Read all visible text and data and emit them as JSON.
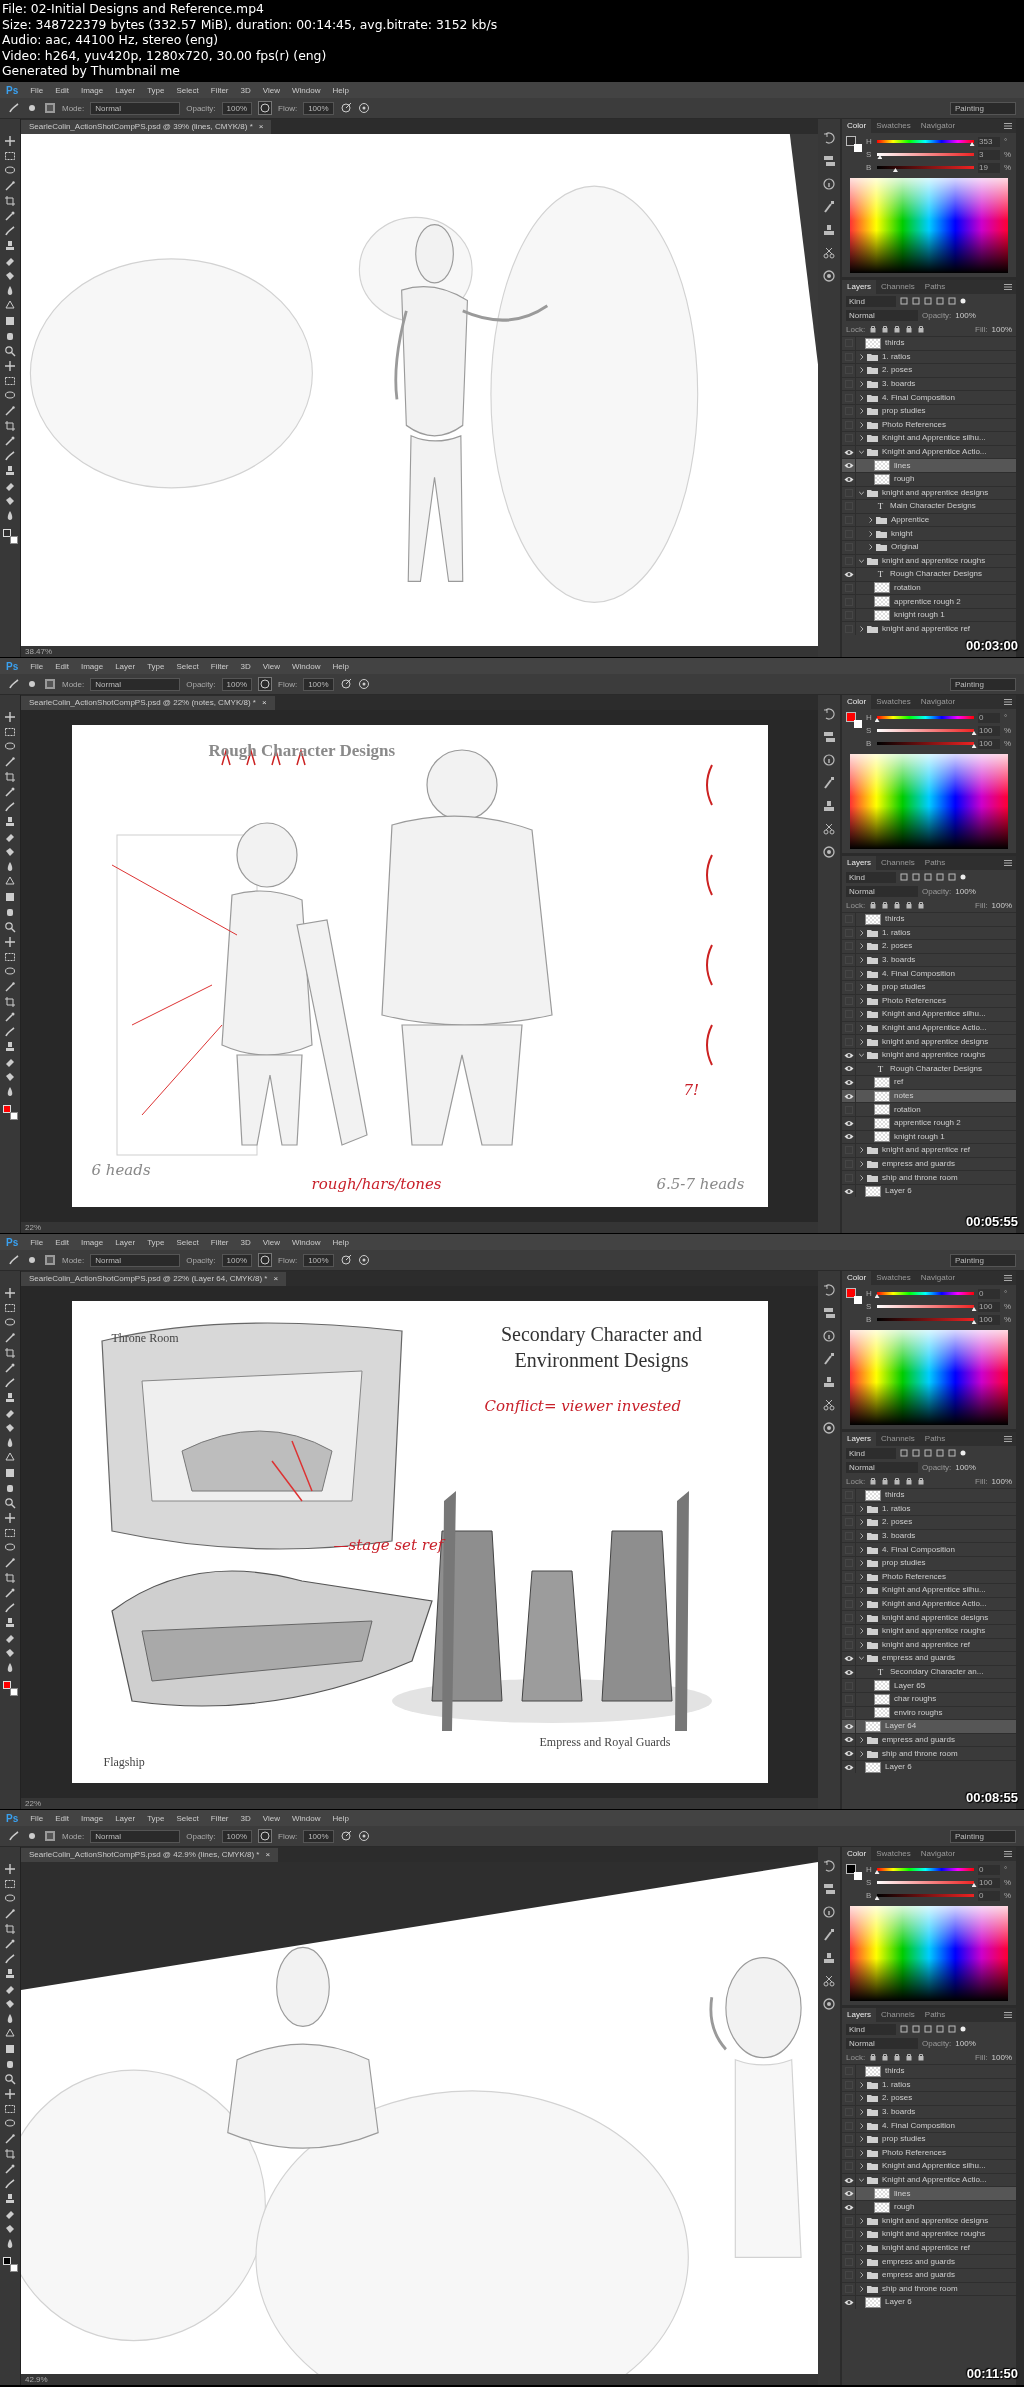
{
  "header": [
    "File: 02-Initial Designs and Reference.mp4",
    "Size: 348722379 bytes (332.57 MiB), duration: 00:14:45, avg.bitrate: 3152 kb/s",
    "Audio: aac, 44100 Hz, stereo (eng)",
    "Video: h264, yuv420p, 1280x720, 30.00 fps(r) (eng)",
    "Generated by Thumbnail me"
  ],
  "frames": [
    {
      "logo": "Ps",
      "menu": [
        "File",
        "Edit",
        "Image",
        "Layer",
        "Type",
        "Select",
        "Filter",
        "3D",
        "View",
        "Window",
        "Help"
      ],
      "options": {
        "mode_label": "Mode:",
        "mode": "Normal",
        "opacity_label": "Opacity:",
        "opacity": "100%",
        "flow_label": "Flow:",
        "flow": "100%",
        "workspace": "Painting"
      },
      "doc_tab": "SearleColin_ActionShotCompPS.psd @ 39% (lines, CMYK/8) *",
      "close": "×",
      "canvas": {
        "kind": "figure_sketch"
      },
      "color_tabs": [
        {
          "label": "Color",
          "selected": true
        },
        {
          "label": "Swatches",
          "selected": false
        },
        {
          "label": "Navigator",
          "selected": false
        }
      ],
      "color": {
        "sliders": [
          {
            "label": "H",
            "value": "353",
            "unit": "°",
            "level": 0.98
          },
          {
            "label": "S",
            "value": "3",
            "unit": "%",
            "level": 0.03
          },
          {
            "label": "B",
            "value": "19",
            "unit": "%",
            "level": 0.19
          }
        ]
      },
      "layer_tabs": [
        {
          "label": "Layers",
          "selected": true
        },
        {
          "label": "Channels",
          "selected": false
        },
        {
          "label": "Paths",
          "selected": false
        }
      ],
      "layer_controls": {
        "filter": "Kind",
        "blend": "Normal",
        "opacity_label": "Opacity:",
        "opacity": "100%",
        "lock_label": "Lock:",
        "fill_label": "Fill:",
        "fill": "100%"
      },
      "layers": [
        {
          "name": "thirds",
          "kind": "layer",
          "visible": false,
          "selected": false
        },
        {
          "name": "1. ratios",
          "kind": "group",
          "visible": false,
          "selected": false,
          "expanded": false
        },
        {
          "name": "2. poses",
          "kind": "group",
          "visible": false,
          "selected": false,
          "expanded": false
        },
        {
          "name": "3. boards",
          "kind": "group",
          "visible": false,
          "selected": false,
          "expanded": false
        },
        {
          "name": "4. Final Composition",
          "kind": "group",
          "visible": false,
          "selected": false,
          "expanded": false
        },
        {
          "name": "prop studies",
          "kind": "group",
          "visible": false,
          "selected": false,
          "expanded": false
        },
        {
          "name": "Photo References",
          "kind": "group",
          "visible": false,
          "selected": false,
          "expanded": false
        },
        {
          "name": "Knight and Apprentice silhu...",
          "kind": "group",
          "visible": false,
          "selected": false,
          "expanded": false
        },
        {
          "name": "Knight and Apprentice Actio...",
          "kind": "group",
          "visible": true,
          "selected": false,
          "expanded": true,
          "children": [
            {
              "name": "lines",
              "kind": "layer",
              "visible": true,
              "selected": true
            },
            {
              "name": "rough",
              "kind": "layer",
              "visible": true,
              "selected": false
            }
          ]
        },
        {
          "name": "knight and apprentice designs",
          "kind": "group",
          "visible": false,
          "selected": false,
          "expanded": true,
          "children": [
            {
              "name": "Main Character Designs",
              "kind": "text",
              "glyph": "T",
              "visible": false,
              "selected": false
            },
            {
              "name": "Apprentice",
              "kind": "group",
              "visible": false,
              "selected": false,
              "expanded": false
            },
            {
              "name": "knight",
              "kind": "group",
              "visible": false,
              "selected": false,
              "expanded": false
            },
            {
              "name": "Original",
              "kind": "group",
              "visible": false,
              "selected": false,
              "expanded": false
            }
          ]
        },
        {
          "name": "knight and apprentice roughs",
          "kind": "group",
          "visible": false,
          "selected": false,
          "expanded": true,
          "children": [
            {
              "name": "Rough Character Designs",
              "kind": "text",
              "glyph": "T",
              "visible": true,
              "selected": false
            },
            {
              "name": "rotation",
              "kind": "layer",
              "visible": false,
              "selected": false
            },
            {
              "name": "apprentice rough 2",
              "kind": "layer",
              "visible": false,
              "selected": false
            },
            {
              "name": "knight rough 1",
              "kind": "layer",
              "visible": false,
              "selected": false
            }
          ]
        },
        {
          "name": "knight and apprentice ref",
          "kind": "group",
          "visible": false,
          "selected": false,
          "expanded": false
        }
      ],
      "zoom": "38.47%",
      "timestamp": "00:03:00"
    },
    {
      "logo": "Ps",
      "menu": [
        "File",
        "Edit",
        "Image",
        "Layer",
        "Type",
        "Select",
        "Filter",
        "3D",
        "View",
        "Window",
        "Help"
      ],
      "options": {
        "mode_label": "Mode:",
        "mode": "Normal",
        "opacity_label": "Opacity:",
        "opacity": "100%",
        "flow_label": "Flow:",
        "flow": "100%",
        "workspace": "Painting"
      },
      "doc_tab": "SearleColin_ActionShotCompPS.psd @ 22% (notes, CMYK/8) *",
      "close": "×",
      "canvas": {
        "kind": "rough_sheet",
        "texts": [
          {
            "text": "Rough Character Designs",
            "kind": "title"
          },
          {
            "text": "6 heads",
            "kind": "handwriting"
          },
          {
            "text": "rough/hars/tones",
            "kind": "note"
          },
          {
            "text": "6.5-7 heads",
            "kind": "handwriting"
          },
          {
            "text": "7!",
            "kind": "note"
          }
        ]
      },
      "color_tabs": [
        {
          "label": "Color",
          "selected": true
        },
        {
          "label": "Swatches",
          "selected": false
        },
        {
          "label": "Navigator",
          "selected": false
        }
      ],
      "color": {
        "sliders": [
          {
            "label": "H",
            "value": "0",
            "unit": "°",
            "level": 0
          },
          {
            "label": "S",
            "value": "100",
            "unit": "%",
            "level": 1
          },
          {
            "label": "B",
            "value": "100",
            "unit": "%",
            "level": 1
          }
        ]
      },
      "layer_tabs": [
        {
          "label": "Layers",
          "selected": true
        },
        {
          "label": "Channels",
          "selected": false
        },
        {
          "label": "Paths",
          "selected": false
        }
      ],
      "layer_controls": {
        "filter": "Kind",
        "blend": "Normal",
        "opacity_label": "Opacity:",
        "opacity": "100%",
        "lock_label": "Lock:",
        "fill_label": "Fill:",
        "fill": "100%"
      },
      "layers": [
        {
          "name": "thirds",
          "kind": "layer",
          "visible": false,
          "selected": false
        },
        {
          "name": "1. ratios",
          "kind": "group",
          "visible": false,
          "selected": false,
          "expanded": false
        },
        {
          "name": "2. poses",
          "kind": "group",
          "visible": false,
          "selected": false,
          "expanded": false
        },
        {
          "name": "3. boards",
          "kind": "group",
          "visible": false,
          "selected": false,
          "expanded": false
        },
        {
          "name": "4. Final Composition",
          "kind": "group",
          "visible": false,
          "selected": false,
          "expanded": false
        },
        {
          "name": "prop studies",
          "kind": "group",
          "visible": false,
          "selected": false,
          "expanded": false
        },
        {
          "name": "Photo References",
          "kind": "group",
          "visible": false,
          "selected": false,
          "expanded": false
        },
        {
          "name": "Knight and Apprentice silhu...",
          "kind": "group",
          "visible": false,
          "selected": false,
          "expanded": false
        },
        {
          "name": "Knight and Apprentice Actio...",
          "kind": "group",
          "visible": false,
          "selected": false,
          "expanded": false
        },
        {
          "name": "knight and apprentice designs",
          "kind": "group",
          "visible": false,
          "selected": false,
          "expanded": false
        },
        {
          "name": "knight and apprentice roughs",
          "kind": "group",
          "visible": true,
          "selected": false,
          "expanded": true,
          "children": [
            {
              "name": "Rough Character Designs",
              "kind": "text",
              "glyph": "T",
              "visible": true,
              "selected": false
            },
            {
              "name": "ref",
              "kind": "layer",
              "visible": true,
              "selected": false
            },
            {
              "name": "notes",
              "kind": "layer",
              "visible": true,
              "selected": true
            },
            {
              "name": "rotation",
              "kind": "layer",
              "visible": false,
              "selected": false
            },
            {
              "name": "apprentice rough 2",
              "kind": "layer",
              "visible": true,
              "selected": false
            },
            {
              "name": "knight rough 1",
              "kind": "layer",
              "visible": true,
              "selected": false
            }
          ]
        },
        {
          "name": "knight and apprentice ref",
          "kind": "group",
          "visible": false,
          "selected": false,
          "expanded": false
        },
        {
          "name": "empress and guards",
          "kind": "group",
          "visible": false,
          "selected": false,
          "expanded": false
        },
        {
          "name": "ship and throne room",
          "kind": "group",
          "visible": false,
          "selected": false,
          "expanded": false
        },
        {
          "name": "Layer 6",
          "kind": "layer",
          "visible": true,
          "selected": false
        }
      ],
      "zoom": "22%",
      "timestamp": "00:05:55"
    },
    {
      "logo": "Ps",
      "menu": [
        "File",
        "Edit",
        "Image",
        "Layer",
        "Type",
        "Select",
        "Filter",
        "3D",
        "View",
        "Window",
        "Help"
      ],
      "options": {
        "mode_label": "Mode:",
        "mode": "Normal",
        "opacity_label": "Opacity:",
        "opacity": "100%",
        "flow_label": "Flow:",
        "flow": "100%",
        "workspace": "Painting"
      },
      "doc_tab": "SearleColin_ActionShotCompPS.psd @ 22% (Layer 64, CMYK/8) *",
      "close": "×",
      "canvas": {
        "kind": "secondary_sheet",
        "texts": [
          {
            "text": "Throne Room",
            "kind": "caption"
          },
          {
            "text": "Secondary Character and Environment Designs",
            "kind": "heading"
          },
          {
            "text": "Conflict= viewer invested",
            "kind": "note"
          },
          {
            "text": "—stage set ref",
            "kind": "note"
          },
          {
            "text": "Flagship",
            "kind": "caption"
          },
          {
            "text": "Empress and Royal Guards",
            "kind": "caption"
          }
        ]
      },
      "color_tabs": [
        {
          "label": "Color",
          "selected": true
        },
        {
          "label": "Swatches",
          "selected": false
        },
        {
          "label": "Navigator",
          "selected": false
        }
      ],
      "color": {
        "sliders": [
          {
            "label": "H",
            "value": "0",
            "unit": "°",
            "level": 0
          },
          {
            "label": "S",
            "value": "100",
            "unit": "%",
            "level": 1
          },
          {
            "label": "B",
            "value": "100",
            "unit": "%",
            "level": 1
          }
        ]
      },
      "layer_tabs": [
        {
          "label": "Layers",
          "selected": true
        },
        {
          "label": "Channels",
          "selected": false
        },
        {
          "label": "Paths",
          "selected": false
        }
      ],
      "layer_controls": {
        "filter": "Kind",
        "blend": "Normal",
        "opacity_label": "Opacity:",
        "opacity": "100%",
        "lock_label": "Lock:",
        "fill_label": "Fill:",
        "fill": "100%"
      },
      "layers": [
        {
          "name": "thirds",
          "kind": "layer",
          "visible": false,
          "selected": false
        },
        {
          "name": "1. ratios",
          "kind": "group",
          "visible": false,
          "selected": false,
          "expanded": false
        },
        {
          "name": "2. poses",
          "kind": "group",
          "visible": false,
          "selected": false,
          "expanded": false
        },
        {
          "name": "3. boards",
          "kind": "group",
          "visible": false,
          "selected": false,
          "expanded": false
        },
        {
          "name": "4. Final Composition",
          "kind": "group",
          "visible": false,
          "selected": false,
          "expanded": false
        },
        {
          "name": "prop studies",
          "kind": "group",
          "visible": false,
          "selected": false,
          "expanded": false
        },
        {
          "name": "Photo References",
          "kind": "group",
          "visible": false,
          "selected": false,
          "expanded": false
        },
        {
          "name": "Knight and Apprentice silhu...",
          "kind": "group",
          "visible": false,
          "selected": false,
          "expanded": false
        },
        {
          "name": "Knight and Apprentice Actio...",
          "kind": "group",
          "visible": false,
          "selected": false,
          "expanded": false
        },
        {
          "name": "knight and apprentice designs",
          "kind": "group",
          "visible": false,
          "selected": false,
          "expanded": false
        },
        {
          "name": "knight and apprentice roughs",
          "kind": "group",
          "visible": false,
          "selected": false,
          "expanded": false
        },
        {
          "name": "knight and apprentice ref",
          "kind": "group",
          "visible": false,
          "selected": false,
          "expanded": false
        },
        {
          "name": "empress and guards",
          "kind": "group",
          "visible": true,
          "selected": false,
          "expanded": true,
          "children": [
            {
              "name": "Secondary Character an...",
              "kind": "text",
              "glyph": "T",
              "visible": true,
              "selected": false
            },
            {
              "name": "Layer 65",
              "kind": "layer",
              "visible": false,
              "selected": false
            },
            {
              "name": "char roughs",
              "kind": "layer",
              "visible": false,
              "selected": false
            },
            {
              "name": "enviro roughs",
              "kind": "layer",
              "visible": false,
              "selected": false
            }
          ]
        },
        {
          "name": "Layer 64",
          "kind": "layer",
          "visible": true,
          "selected": true
        },
        {
          "name": "empress and guards",
          "kind": "group",
          "visible": true,
          "selected": false,
          "expanded": false
        },
        {
          "name": "ship and throne room",
          "kind": "group",
          "visible": true,
          "selected": false,
          "expanded": false
        },
        {
          "name": "Layer 6",
          "kind": "layer",
          "visible": true,
          "selected": false
        }
      ],
      "zoom": "22%",
      "timestamp": "00:08:55"
    },
    {
      "logo": "Ps",
      "menu": [
        "File",
        "Edit",
        "Image",
        "Layer",
        "Type",
        "Select",
        "Filter",
        "3D",
        "View",
        "Window",
        "Help"
      ],
      "options": {
        "mode_label": "Mode:",
        "mode": "Normal",
        "opacity_label": "Opacity:",
        "opacity": "100%",
        "flow_label": "Flow:",
        "flow": "100%",
        "workspace": "Painting"
      },
      "doc_tab": "SearleColin_ActionShotCompPS.psd @ 42.9% (lines, CMYK/8) *",
      "close": "×",
      "canvas": {
        "kind": "portrait_sketch"
      },
      "color_tabs": [
        {
          "label": "Color",
          "selected": true
        },
        {
          "label": "Swatches",
          "selected": false
        },
        {
          "label": "Navigator",
          "selected": false
        }
      ],
      "color": {
        "sliders": [
          {
            "label": "H",
            "value": "0",
            "unit": "°",
            "level": 0
          },
          {
            "label": "S",
            "value": "100",
            "unit": "%",
            "level": 1
          },
          {
            "label": "B",
            "value": "0",
            "unit": "%",
            "level": 0
          }
        ]
      },
      "layer_tabs": [
        {
          "label": "Layers",
          "selected": true
        },
        {
          "label": "Channels",
          "selected": false
        },
        {
          "label": "Paths",
          "selected": false
        }
      ],
      "layer_controls": {
        "filter": "Kind",
        "blend": "Normal",
        "opacity_label": "Opacity:",
        "opacity": "100%",
        "lock_label": "Lock:",
        "fill_label": "Fill:",
        "fill": "100%"
      },
      "layers": [
        {
          "name": "thirds",
          "kind": "layer",
          "visible": false,
          "selected": false
        },
        {
          "name": "1. ratios",
          "kind": "group",
          "visible": false,
          "selected": false,
          "expanded": false
        },
        {
          "name": "2. poses",
          "kind": "group",
          "visible": false,
          "selected": false,
          "expanded": false
        },
        {
          "name": "3. boards",
          "kind": "group",
          "visible": false,
          "selected": false,
          "expanded": false
        },
        {
          "name": "4. Final Composition",
          "kind": "group",
          "visible": false,
          "selected": false,
          "expanded": false
        },
        {
          "name": "prop studies",
          "kind": "group",
          "visible": false,
          "selected": false,
          "expanded": false
        },
        {
          "name": "Photo References",
          "kind": "group",
          "visible": false,
          "selected": false,
          "expanded": false
        },
        {
          "name": "Knight and Apprentice silhu...",
          "kind": "group",
          "visible": false,
          "selected": false,
          "expanded": false
        },
        {
          "name": "Knight and Apprentice Actio...",
          "kind": "group",
          "visible": true,
          "selected": false,
          "expanded": true,
          "children": [
            {
              "name": "lines",
              "kind": "layer",
              "visible": true,
              "selected": true
            },
            {
              "name": "rough",
              "kind": "layer",
              "visible": true,
              "selected": false
            }
          ]
        },
        {
          "name": "knight and apprentice designs",
          "kind": "group",
          "visible": false,
          "selected": false,
          "expanded": false
        },
        {
          "name": "knight and apprentice roughs",
          "kind": "group",
          "visible": false,
          "selected": false,
          "expanded": false
        },
        {
          "name": "knight and apprentice ref",
          "kind": "group",
          "visible": false,
          "selected": false,
          "expanded": false
        },
        {
          "name": "empress and guards",
          "kind": "group",
          "visible": false,
          "selected": false,
          "expanded": false
        },
        {
          "name": "empress and guards",
          "kind": "group",
          "visible": false,
          "selected": false,
          "expanded": false
        },
        {
          "name": "ship and throne room",
          "kind": "group",
          "visible": false,
          "selected": false,
          "expanded": false
        },
        {
          "name": "Layer 6",
          "kind": "layer",
          "visible": true,
          "selected": false
        }
      ],
      "zoom": "42.9%",
      "timestamp": "00:11:50"
    }
  ]
}
